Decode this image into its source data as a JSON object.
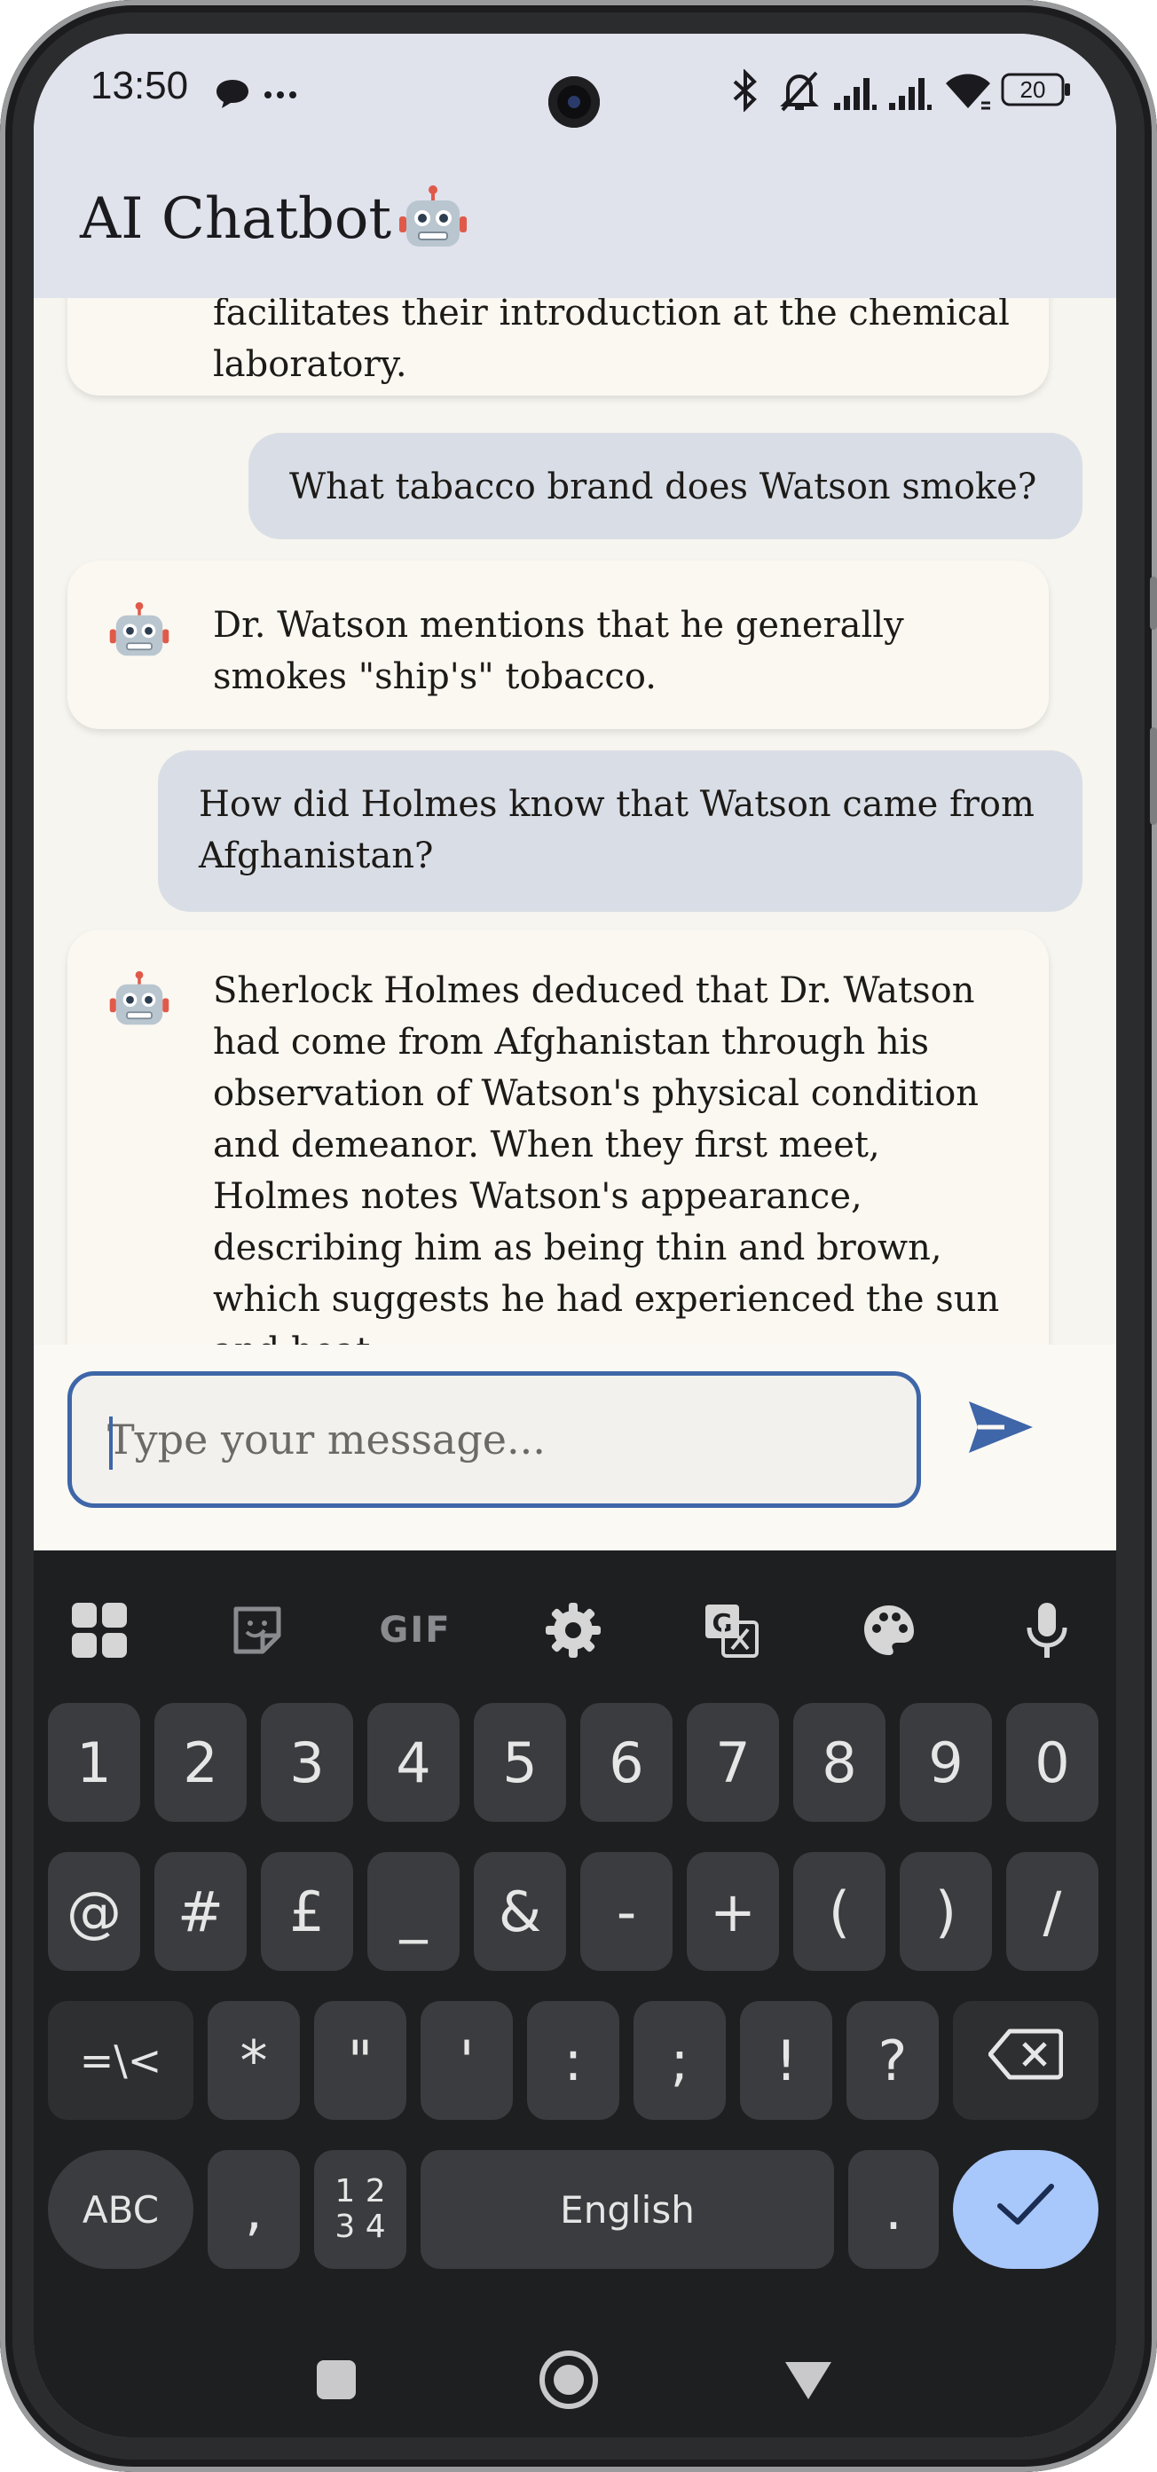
{
  "status_bar": {
    "time": "13:50",
    "battery": "20"
  },
  "app_bar": {
    "title": "AI Chatbot"
  },
  "messages": [
    {
      "role": "bot",
      "text": "facilitates their introduction at the chemical laboratory."
    },
    {
      "role": "user",
      "text": "What tabacco brand does Watson smoke?"
    },
    {
      "role": "bot",
      "text": "Dr. Watson mentions that he generally smokes \"ship's\" tobacco."
    },
    {
      "role": "user",
      "text": "How did Holmes know that Watson came from Afghanistan?"
    },
    {
      "role": "bot",
      "text": "Sherlock Holmes deduced that Dr. Watson had come from Afghanistan through his observation of Watson's physical condition and demeanor. When they first meet, Holmes notes Watson's appearance, describing him as being thin and brown, which suggests he had experienced the sun and heat."
    }
  ],
  "composer": {
    "placeholder": "Type your message..."
  },
  "keyboard": {
    "toolbar_icons": [
      "apps-grid-icon",
      "sticker-icon",
      "gif-icon",
      "settings-gear-icon",
      "translate-icon",
      "palette-icon",
      "microphone-icon"
    ],
    "gif_label": "GIF",
    "row1": [
      "1",
      "2",
      "3",
      "4",
      "5",
      "6",
      "7",
      "8",
      "9",
      "0"
    ],
    "row2": [
      "@",
      "#",
      "£",
      "_",
      "&",
      "-",
      "+",
      "(",
      ")",
      "/"
    ],
    "row3": [
      "=\\<",
      "*",
      "\"",
      "'",
      ":",
      ";",
      "!",
      "?"
    ],
    "abc_label": "ABC",
    "comma": ",",
    "numpad_top": "1 2",
    "numpad_bottom": "3 4",
    "space_label": "English",
    "period": "."
  },
  "colors": {
    "app_bar": "#e0e2ec",
    "chat_bg": "#f7f5ef",
    "user_bubble": "#d9dee6",
    "accent": "#3e66a8",
    "keyboard_bg": "#1e1f21",
    "key": "#3b3c3f",
    "enter_key": "#a8c7fa"
  }
}
